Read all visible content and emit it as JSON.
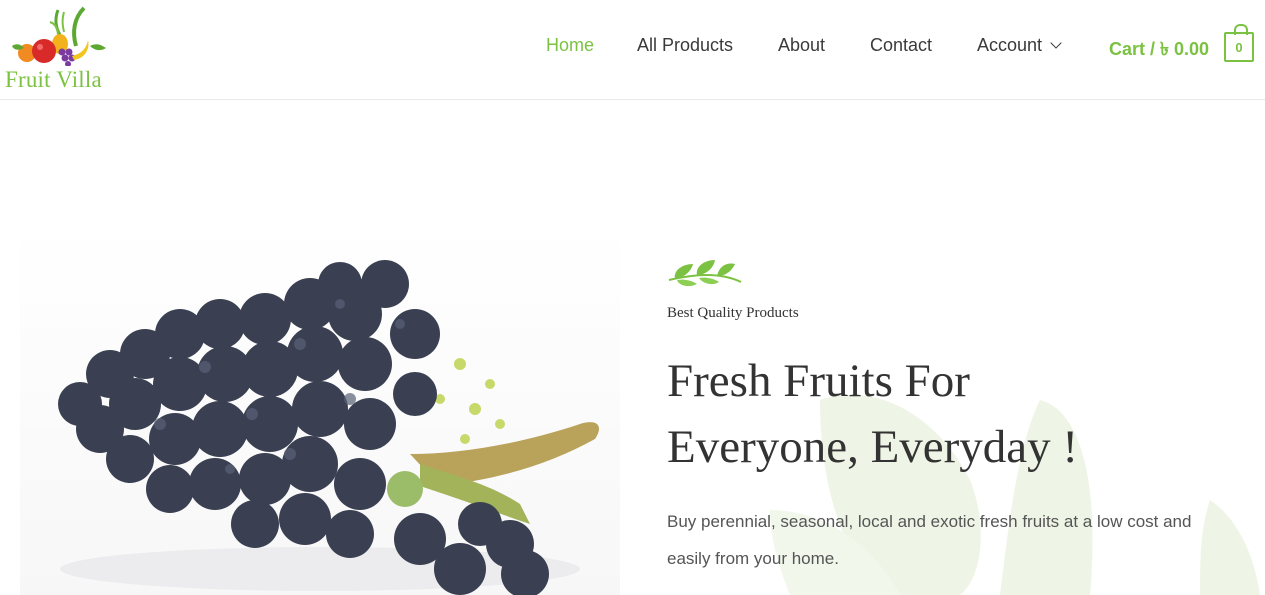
{
  "brand": {
    "name": "Fruit Villa",
    "color": "#7cc242"
  },
  "nav": {
    "items": [
      {
        "label": "Home",
        "active": true
      },
      {
        "label": "All Products",
        "active": false
      },
      {
        "label": "About",
        "active": false
      },
      {
        "label": "Contact",
        "active": false
      },
      {
        "label": "Account",
        "active": false,
        "has_dropdown": true
      }
    ]
  },
  "cart": {
    "label": "Cart / ৳ 0.00",
    "count": "0"
  },
  "hero": {
    "kicker": "Best Quality Products",
    "headline_line1": "Fresh Fruits For",
    "headline_line2": "Everyone, Everyday !",
    "description": "Buy perennial, seasonal, local and exotic fresh fruits at a low cost and easily from your home."
  },
  "icons": {
    "logo": "fruit-basket-logo",
    "sprig": "leaf-sprig-icon",
    "dropdown": "chevron-down-icon",
    "cart": "shopping-bag-icon"
  }
}
